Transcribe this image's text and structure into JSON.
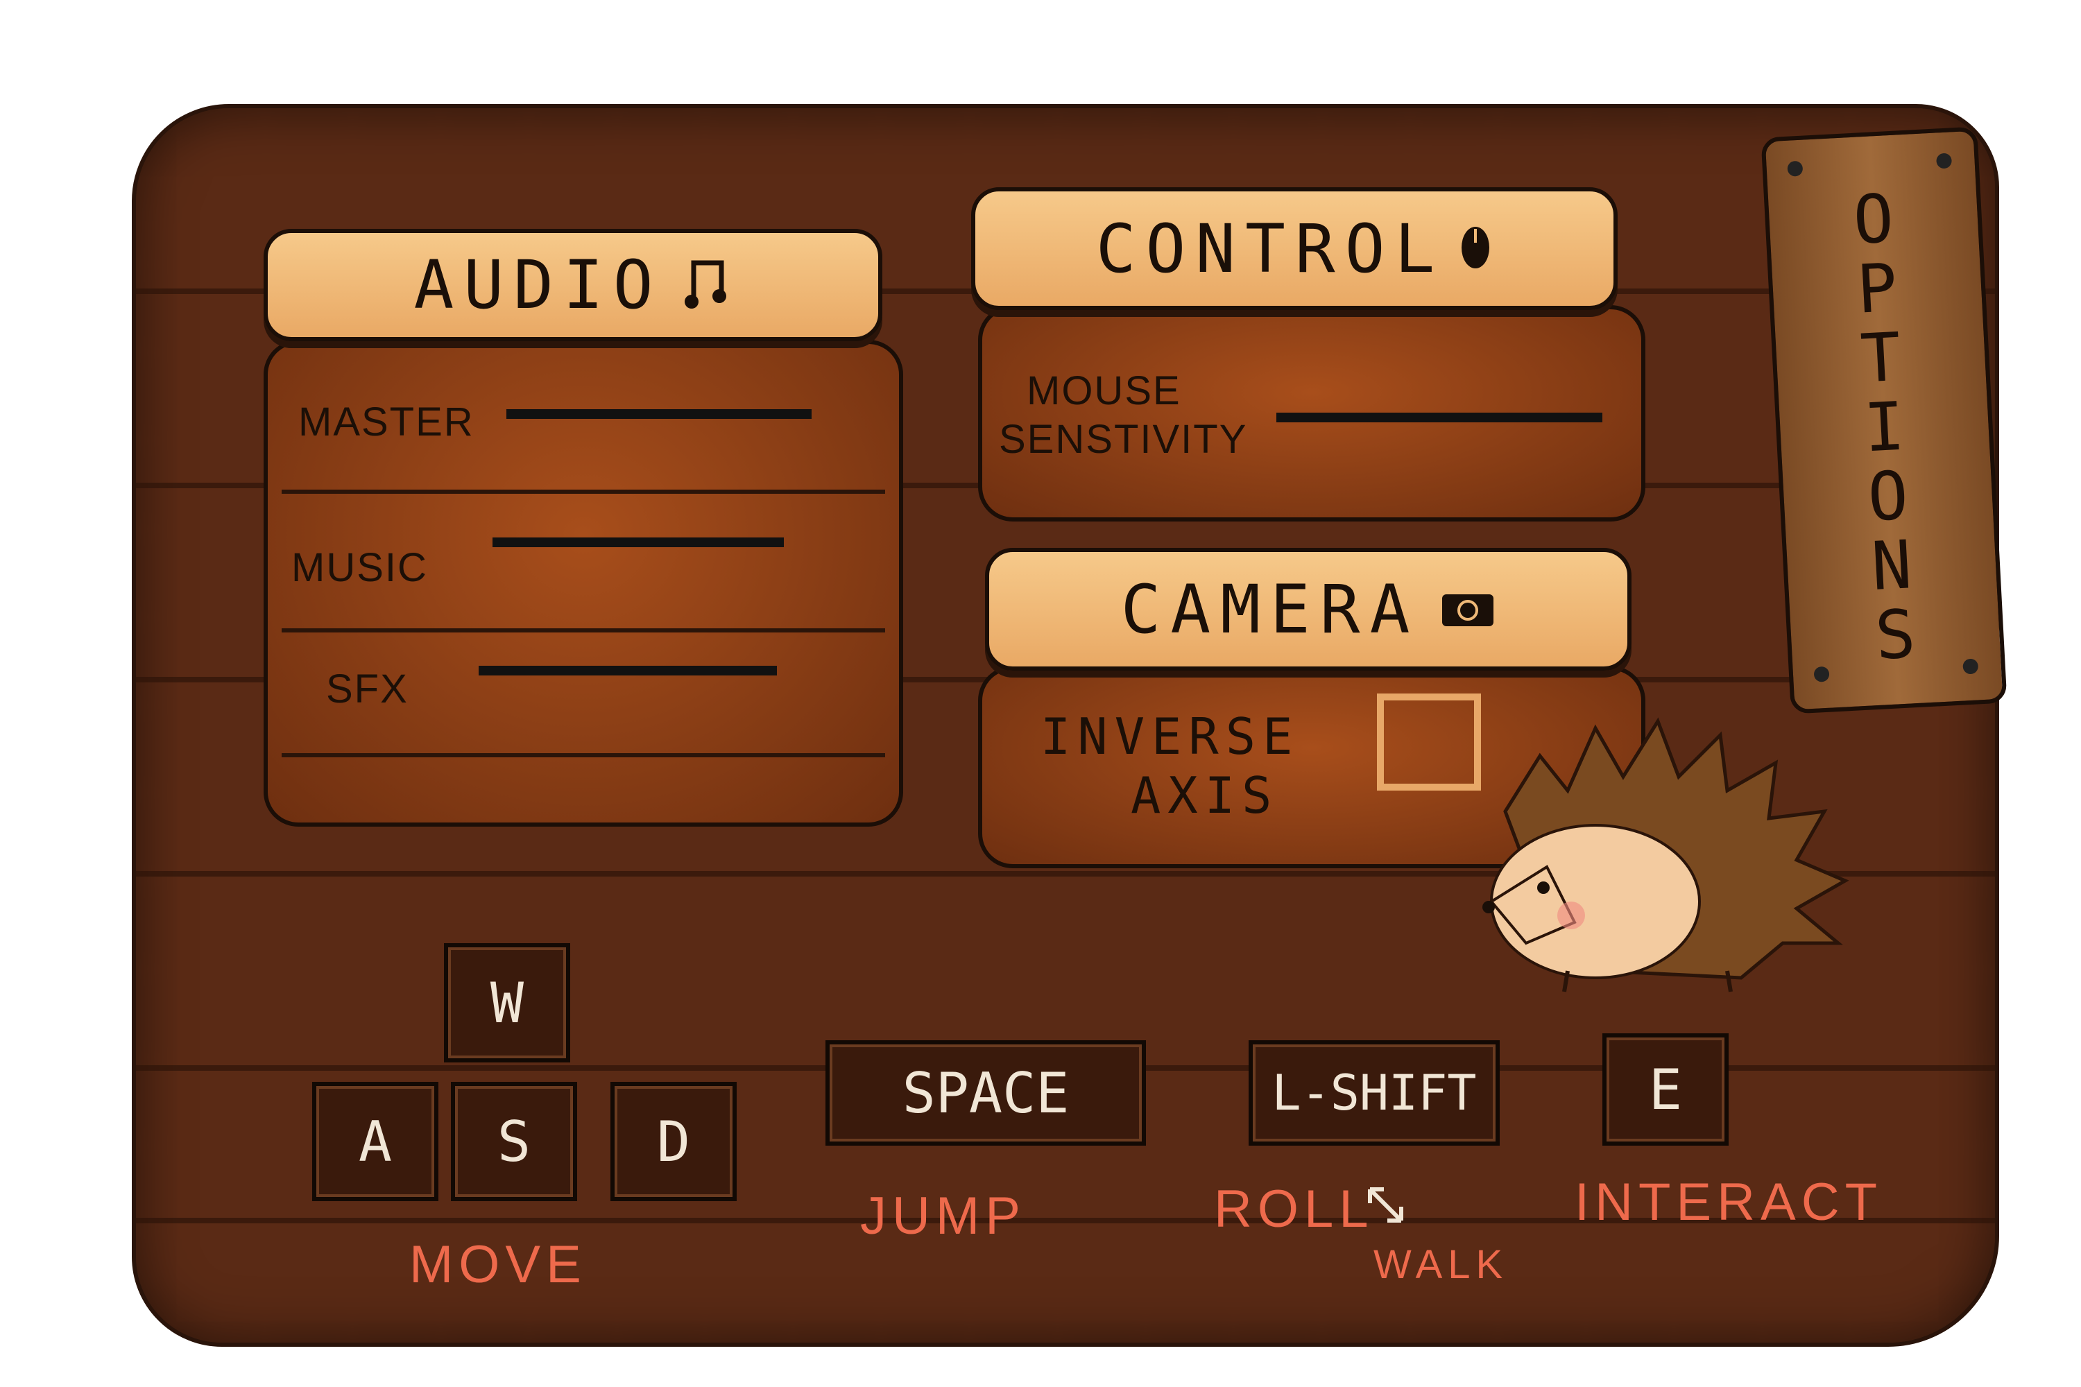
{
  "sign": {
    "title": "OPTIONS"
  },
  "audio": {
    "title": "AUDIO",
    "rows": [
      {
        "label": "MASTER",
        "value": 1.0
      },
      {
        "label": "MUSIC",
        "value": 1.0
      },
      {
        "label": "SFX",
        "value": 1.0
      }
    ]
  },
  "control": {
    "title": "CONTROL",
    "rows": [
      {
        "label_line1": "MOUSE",
        "label_line2": "SENSTIVITY",
        "value": 1.0
      }
    ]
  },
  "camera": {
    "title": "CAMERA",
    "inverse_line1": "INVERSE",
    "inverse_line2": "AXIS",
    "inverse_checked": false
  },
  "keys": {
    "w": "W",
    "a": "A",
    "s": "S",
    "d": "D",
    "space": "SPACE",
    "shift": "L-SHIFT",
    "e": "E"
  },
  "actions": {
    "move": "MOVE",
    "jump": "JUMP",
    "roll": "ROLL",
    "walk": "WALK",
    "interact": "INTERACT"
  },
  "colors": {
    "panel_head": "#f0b978",
    "panel_body": "#8e3f16",
    "board": "#5a2a15",
    "action_text": "#ee6a4c"
  },
  "icons": {
    "audio": "music-note-icon",
    "control": "mouse-icon",
    "camera": "camera-icon",
    "roll": "swap-arrows-icon"
  }
}
